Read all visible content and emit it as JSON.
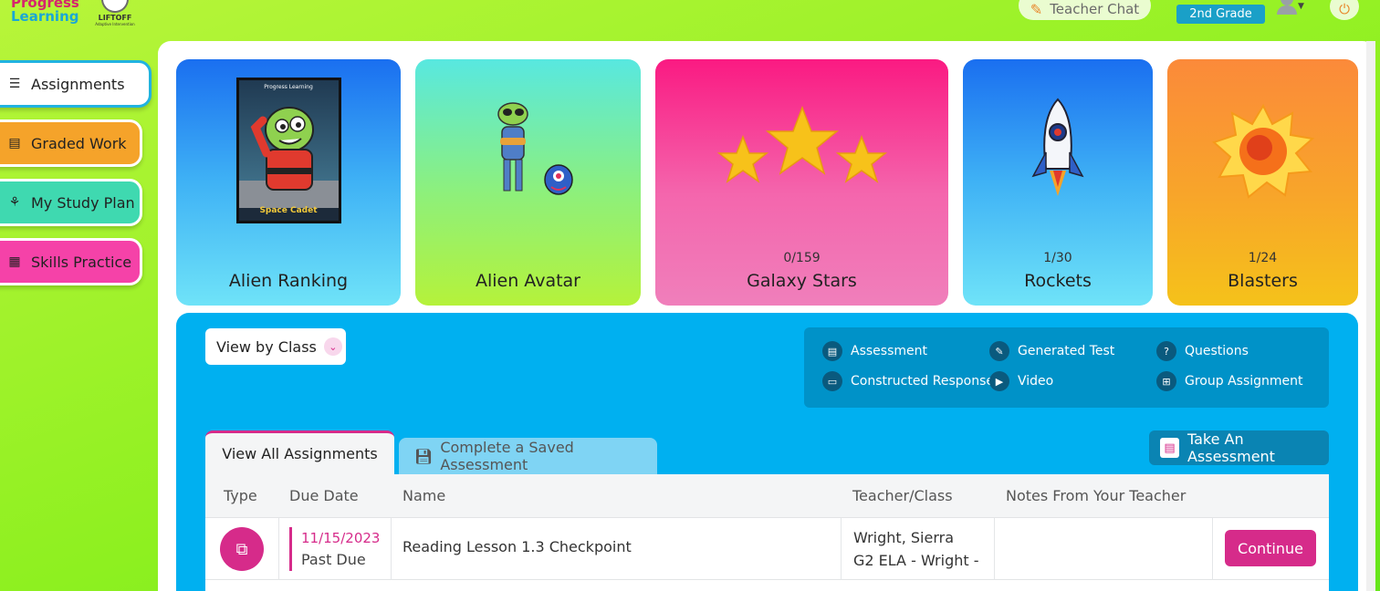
{
  "header": {
    "brand_line1": "Progress",
    "brand_line2": "Learning",
    "liftoff_label": "LIFTOFF",
    "liftoff_sub": "Adaptive Intervention",
    "teacher_chat": "Teacher Chat",
    "grade": "2nd Grade"
  },
  "sidebar": {
    "items": [
      {
        "label": "Assignments",
        "icon": "stack-icon"
      },
      {
        "label": "Graded Work",
        "icon": "clipboard-icon"
      },
      {
        "label": "My Study Plan",
        "icon": "basket-icon"
      },
      {
        "label": "Skills Practice",
        "icon": "practice-icon"
      }
    ]
  },
  "cards": {
    "alien_ranking": {
      "title": "Alien Ranking",
      "poster_top": "Progress Learning",
      "poster_caption": "Space Cadet"
    },
    "alien_avatar": {
      "title": "Alien Avatar"
    },
    "galaxy_stars": {
      "title": "Galaxy Stars",
      "count": "0/159"
    },
    "rockets": {
      "title": "Rockets",
      "count": "1/30"
    },
    "blasters": {
      "title": "Blasters",
      "count": "1/24"
    }
  },
  "filters": {
    "view_select": "View by Class"
  },
  "legend": {
    "assessment": "Assessment",
    "generated_test": "Generated Test",
    "questions": "Questions",
    "constructed_response": "Constructed Response",
    "video": "Video",
    "group_assignment": "Group Assignment"
  },
  "tabs": {
    "all": "View All Assignments",
    "saved": "Complete a Saved Assessment"
  },
  "take_assessment": "Take An Assessment",
  "table": {
    "headers": {
      "type": "Type",
      "due_date": "Due Date",
      "name": "Name",
      "teacher": "Teacher/Class",
      "notes": "Notes From Your Teacher"
    },
    "rows": [
      {
        "due_date": "11/15/2023",
        "status": "Past Due",
        "name": "Reading Lesson 1.3 Checkpoint",
        "teacher": "Wright, Sierra",
        "class": "G2 ELA - Wright -",
        "notes": "",
        "action": "Continue"
      }
    ]
  },
  "colors": {
    "accent_pink": "#d62b8a",
    "panel_blue": "#00b0f0",
    "lime_bg": "#8ef020"
  }
}
